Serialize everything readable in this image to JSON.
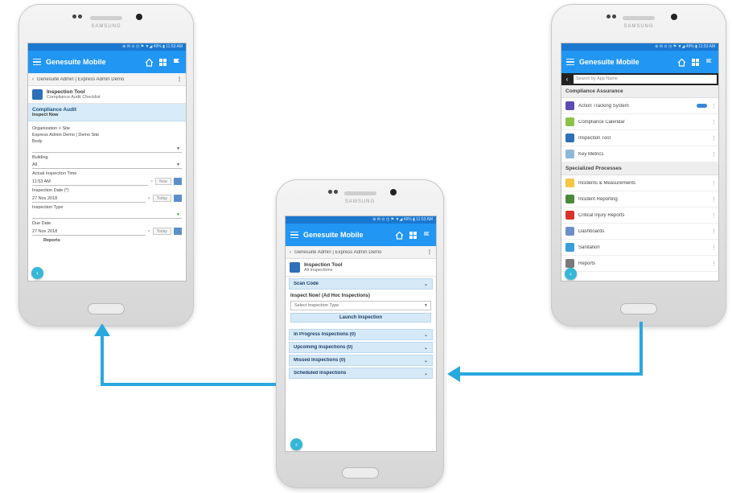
{
  "phone_brand": "SAMSUNG",
  "status_bar": "⊕ ✉ ⊙ ◷ ⚑ ▼◢ 49% ▮ 11:53 AM",
  "app": {
    "title": "Genesuite Mobile"
  },
  "left_phone": {
    "breadcrumb": "Genesuite Admin | Express Admin Demo",
    "tool_title": "Inspection Tool",
    "tool_subtitle": "Compliance Audit Checklist",
    "section_title": "Compliance Audit",
    "section_subtitle": "Inspect Now",
    "org_label": "Organization > Site",
    "org_value": "Express Admin Demo | Demo Site",
    "field_body_label": "Body",
    "field_bldg_label": "Building",
    "field_bldg_value": "All",
    "actual_time_label": "Actual Inspection Time",
    "actual_time_value": "11:53 AM",
    "btn_now": "Now",
    "insp_date_label": "Inspection Date (*)",
    "insp_date_value": "27 Nov 2018",
    "btn_today": "Today",
    "insp_type_label": "Inspection Type",
    "due_date_label": "Due Date",
    "due_date_value": "27 Nov 2018",
    "reports_label": "Reports"
  },
  "middle_phone": {
    "breadcrumb": "Genesuite Admin | Express Admin Demo",
    "tool_title": "Inspection Tool",
    "tool_subtitle": "All Inspections",
    "scan_code": "Scan Code",
    "inspect_now_label": "Inspect Now! (Ad Hoc Inspections)",
    "select_placeholder": "Select Inspection Type",
    "launch_button": "Launch Inspection",
    "sections": [
      "In Progress Inspections (0)",
      "Upcoming Inspections (0)",
      "Missed Inspections (0)",
      "Scheduled Inspections"
    ]
  },
  "right_phone": {
    "search_placeholder": "Search by App Name",
    "category_1": "Compliance Assurance",
    "items_1": [
      "Action Tracking System",
      "Compliance Calendar",
      "Inspection Tool",
      "Key Metrics"
    ],
    "category_2": "Specialized Processes",
    "items_2": [
      "Incidents & Measurements",
      "Incident Reporting",
      "Critical Injury Reports",
      "Dashboards",
      "Sanitation",
      "Reports"
    ]
  },
  "colors": {
    "app_bar": "#2196f3",
    "arrow": "#29a8e0",
    "section_bg": "#d5e9f7"
  }
}
